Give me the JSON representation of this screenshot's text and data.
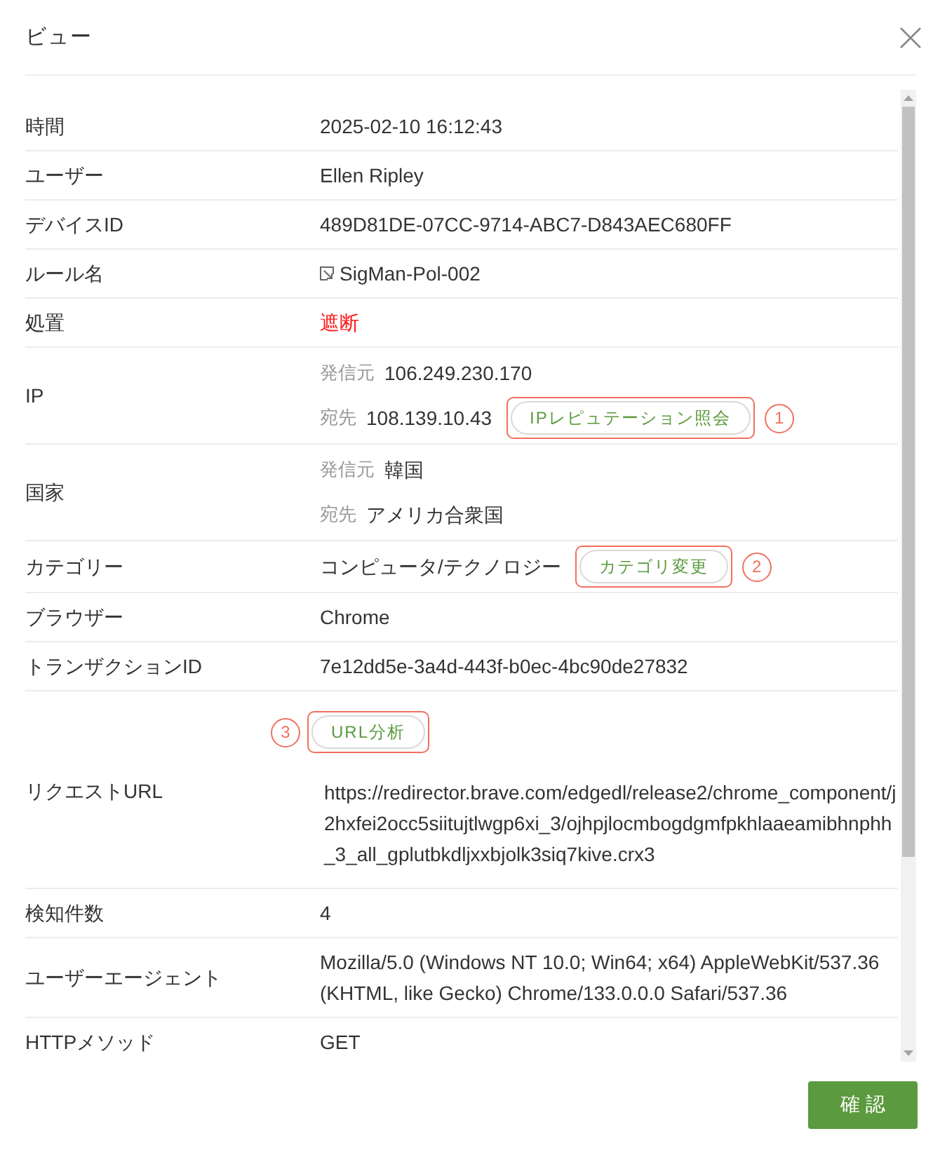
{
  "dialog": {
    "title": "ビュー"
  },
  "fields": [
    {
      "kind": "text",
      "label": "時間",
      "value": "2025-02-10 16:12:43"
    },
    {
      "kind": "text",
      "label": "ユーザー",
      "value": "Ellen Ripley"
    },
    {
      "kind": "text",
      "label": "デバイスID",
      "value": "489D81DE-07CC-9714-ABC7-D843AEC680FF"
    },
    {
      "kind": "link",
      "label": "ルール名",
      "value": "SigMan-Pol-002"
    },
    {
      "kind": "alert",
      "label": "処置",
      "value": "遮断"
    },
    {
      "kind": "pairs",
      "label": "IP",
      "lines": [
        {
          "label": "発信元",
          "value": "106.249.230.170"
        },
        {
          "label": "宛先",
          "value": "108.139.10.43",
          "action": {
            "label": "IPレピュテーション照会",
            "marker": "1"
          }
        }
      ]
    },
    {
      "kind": "pairs",
      "label": "国家",
      "lines": [
        {
          "label": "発信元",
          "value": "韓国"
        },
        {
          "label": "宛先",
          "value": "アメリカ合衆国"
        }
      ]
    },
    {
      "kind": "text",
      "label": "カテゴリー",
      "value": "コンピュータ/テクノロジー",
      "action": {
        "label": "カテゴリ変更",
        "marker": "2"
      }
    },
    {
      "kind": "text",
      "label": "ブラウザー",
      "value": "Chrome"
    },
    {
      "kind": "text",
      "label": "トランザクションID",
      "value": "7e12dd5e-3a4d-443f-b0ec-4bc90de27832"
    },
    {
      "kind": "action_above",
      "label": "リクエストURL",
      "value": "https://redirector.brave.com/edgedl/release2/chrome_component/j2hxfei2occ5siitujtlwgp6xi_3/ojhpjlocmbogdgmfpkhlaaeamibhnphh_3_all_gplutbkdljxxbjolk3siq7kive.crx3",
      "action": {
        "label": "URL分析",
        "marker": "3"
      }
    },
    {
      "kind": "text",
      "label": "検知件数",
      "value": "4"
    },
    {
      "kind": "text",
      "label": "ユーザーエージェント",
      "value": "Mozilla/5.0 (Windows NT 10.0; Win64; x64) AppleWebKit/537.36 (KHTML, like Gecko) Chrome/133.0.0.0 Safari/537.36"
    },
    {
      "kind": "text",
      "label": "HTTPメソッド",
      "value": "GET"
    }
  ],
  "footer": {
    "buttons": [
      "確 認"
    ]
  }
}
